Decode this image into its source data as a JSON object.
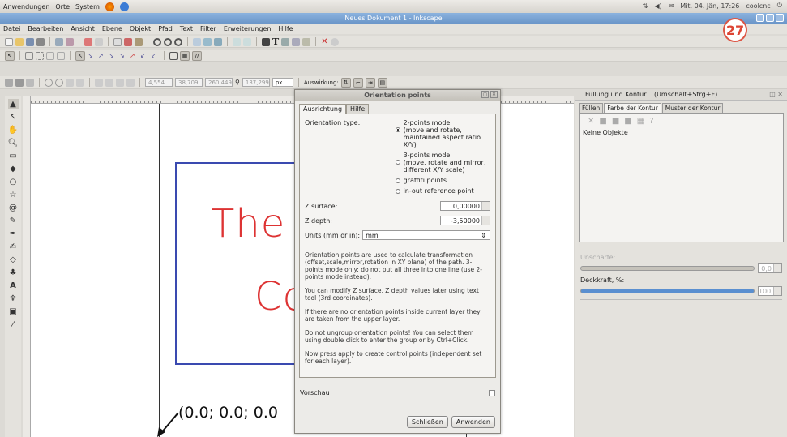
{
  "system_bar": {
    "apps": "Anwendungen",
    "places": "Orte",
    "system": "System",
    "datetime": "Mit, 04. Jän, 17:26",
    "user": "coolcnc"
  },
  "window": {
    "title": "Neues Dokument 1 - Inkscape"
  },
  "menu": [
    "Datei",
    "Bearbeiten",
    "Ansicht",
    "Ebene",
    "Objekt",
    "Pfad",
    "Text",
    "Filter",
    "Erweiterungen",
    "Hilfe"
  ],
  "toolbar3": {
    "x": "4,554",
    "y": "38,709",
    "w": "260,449",
    "h": "137,299",
    "unit": "px",
    "effect_label": "Auswirkung:"
  },
  "canvas": {
    "line1": "The C",
    "line2": "Co",
    "coord_text": "(0.0; 0.0; 0.0"
  },
  "dialog": {
    "title": "Orientation points",
    "tabs": [
      "Ausrichtung",
      "Hilfe"
    ],
    "orientation_type_label": "Orientation type:",
    "options": [
      {
        "label": "2-points mode\n(move and rotate,\nmaintained aspect ratio X/Y)",
        "checked": true
      },
      {
        "label": "3-points mode\n(move, rotate and mirror,\ndifferent X/Y scale)",
        "checked": false
      },
      {
        "label": "graffiti points",
        "checked": false
      },
      {
        "label": "in-out reference point",
        "checked": false
      }
    ],
    "z_surface_label": "Z surface:",
    "z_surface_value": "0,00000",
    "z_depth_label": "Z depth:",
    "z_depth_value": "-3,50000",
    "units_label": "Units (mm or in):",
    "units_value": "mm",
    "desc1": "Orientation points are used to calculate transformation (offset,scale,mirror,rotation in XY plane) of the path. 3-points mode only: do not put all three into one line (use 2-points mode instead).",
    "desc2": "You can modify Z surface, Z depth values later using text tool (3rd coordinates).",
    "desc3": "If there are no orientation points inside current layer they are taken from the upper layer.",
    "desc4": "Do not ungroup orientation points! You can select them using double click to enter the group or by Ctrl+Click.",
    "desc5": "Now press apply to create control points (independent set for each layer).",
    "preview_label": "Vorschau",
    "close_button": "Schließen",
    "apply_button": "Anwenden"
  },
  "right_panel": {
    "title": "Füllung und Kontur... (Umschalt+Strg+F)",
    "tabs": [
      "Füllen",
      "Farbe der Kontur",
      "Muster der Kontur"
    ],
    "no_objects": "Keine Objekte",
    "blur_label": "Unschärfe:",
    "blur_value": "0,0",
    "opacity_label": "Deckkraft, %:",
    "opacity_value": "100,0"
  },
  "badge": "27"
}
